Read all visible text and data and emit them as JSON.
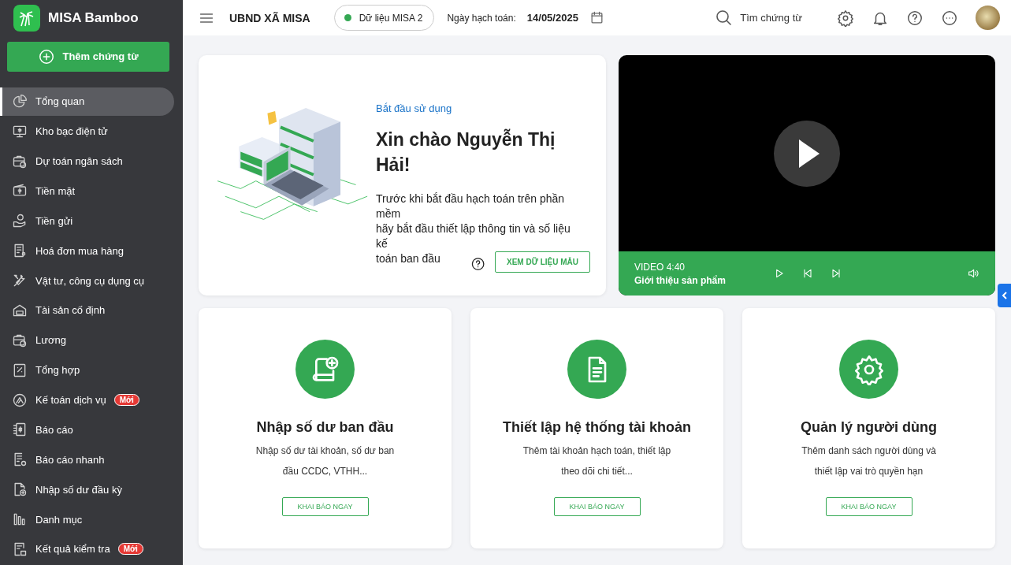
{
  "app": {
    "name": "MISA Bamboo"
  },
  "sidebar": {
    "add_button": "Thêm chứng từ",
    "items": [
      {
        "label": "Tổng quan",
        "selected": true
      },
      {
        "label": "Kho bạc điện tử",
        "selected": false
      },
      {
        "label": "Dự toán ngân sách",
        "selected": false
      },
      {
        "label": "Tiền mặt",
        "selected": false
      },
      {
        "label": "Tiền gửi",
        "selected": false
      },
      {
        "label": "Hoá đơn mua hàng",
        "selected": false
      },
      {
        "label": "Vật tư, công cụ dụng cụ",
        "selected": false
      },
      {
        "label": "Tài sản cố định",
        "selected": false
      },
      {
        "label": "Lương",
        "selected": false
      },
      {
        "label": "Tổng hợp",
        "selected": false
      },
      {
        "label": "Kế toán dịch vụ",
        "selected": false,
        "badge": "Mới"
      },
      {
        "label": "Báo cáo",
        "selected": false
      },
      {
        "label": "Báo cáo nhanh",
        "selected": false
      },
      {
        "label": "Nhập số dư đầu kỳ",
        "selected": false
      },
      {
        "label": "Danh mục",
        "selected": false
      },
      {
        "label": "Kết quả kiểm tra",
        "selected": false,
        "badge": "Mới"
      }
    ]
  },
  "header": {
    "organization": "UBND XÃ MISA",
    "database": "Dữ liệu MISA 2",
    "date_label": "Ngày hạch toán:",
    "date": "14/05/2025",
    "search_placeholder": "Tìm chứng từ"
  },
  "welcome": {
    "link": "Bắt đầu sử dụng",
    "title": "Xin chào Nguyễn Thị\nHải!",
    "text_lines": [
      "Trước khi bắt đầu hạch toán trên phần",
      "mềm",
      "hãy bắt đầu thiết lập thông tin và số liệu",
      "kế",
      "toán ban đầu"
    ],
    "button": "XEM DỮ LIỆU MẪU"
  },
  "video": {
    "duration": "VIDEO 4:40",
    "title": "Giới thiệu sản phẩm"
  },
  "cards": [
    {
      "title": "Nhập số dư ban đầu",
      "text": "Nhập số dư tài khoản, số dư ban\nđầu CCDC, VTHH...",
      "button": "KHAI BÁO NGAY"
    },
    {
      "title": "Thiết lập hệ thống tài khoản",
      "text": "Thêm tài khoản hạch toán, thiết lập\ntheo dõi chi tiết...",
      "button": "KHAI BÁO NGAY"
    },
    {
      "title": "Quản lý người dùng",
      "text": "Thêm danh sách người dùng và\nthiết lập vai trò quyền hạn",
      "button": "KHAI BÁO NGAY"
    }
  ]
}
